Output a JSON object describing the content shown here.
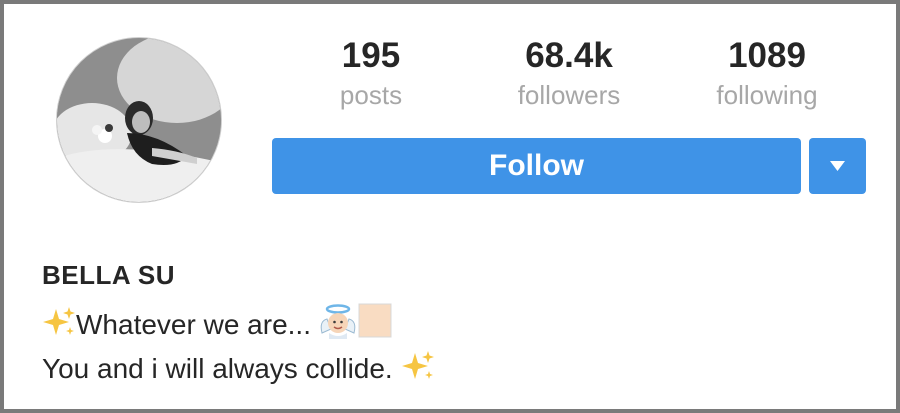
{
  "profile": {
    "display_name": "BELLA SU",
    "avatar_icon": "profile-photo"
  },
  "stats": [
    {
      "value": "195",
      "label": "posts"
    },
    {
      "value": "68.4k",
      "label": "followers"
    },
    {
      "value": "1089",
      "label": "following"
    }
  ],
  "actions": {
    "follow_label": "Follow",
    "dropdown_icon": "triangle-down-icon"
  },
  "bio": {
    "line1_text": "Whatever we are... ",
    "line1_leading_emoji": "sparkles-icon",
    "line1_trailing_emoji": [
      "angel-emoji",
      "skin-tone-swatch"
    ],
    "line2_text": "You and i will always collide. ",
    "line2_trailing_emoji": "sparkles-icon"
  },
  "colors": {
    "accent": "#3f93e7",
    "text": "#262626",
    "muted": "#a7a7a7",
    "frame": "#7a7a7a"
  }
}
